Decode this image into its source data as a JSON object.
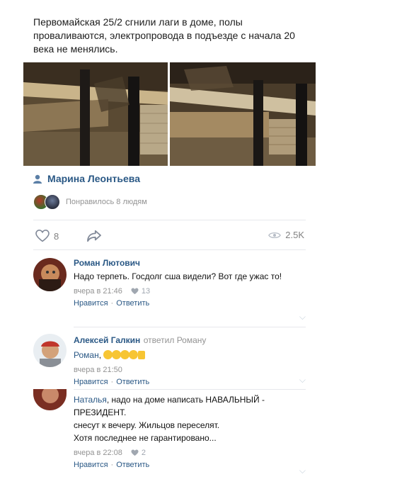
{
  "post": {
    "text": "Первомайская 25/2 сгнили лаги в доме, полы проваливаются, электропровода в подъезде с начала 20 века не менялись.",
    "author": "Марина Леонтьева",
    "likes_text": "Понравилось 8 людям",
    "like_count": "8",
    "views": "2.5K"
  },
  "comments": [
    {
      "name": "Роман Лютович",
      "text": "Надо терпеть. Госдолг сша видели? Вот где ужас то!",
      "time": "вчера в 21:46",
      "likes": "13",
      "like_label": "Нравится",
      "reply_label": "Ответить"
    },
    {
      "name": "Алексей Галкин",
      "reply_to": "ответил Роману",
      "mention": "Роман",
      "text_suffix": ",",
      "time": "вчера в 21:50",
      "like_label": "Нравится",
      "reply_label": "Ответить"
    },
    {
      "mention": "Наталья",
      "text": ", надо на доме написать НАВАЛЬНЫЙ - ПРЕЗИДЕНТ.",
      "line2": "снесут к вечеру. Жильцов переселят.",
      "line3": "Хотя последнее не гарантировано...",
      "time": "вчера в 22:08",
      "likes": "2",
      "like_label": "Нравится",
      "reply_label": "Ответить"
    }
  ],
  "separator": "·",
  "icons": {
    "author": "user-icon",
    "like": "heart-icon",
    "share": "share-icon",
    "views": "eye-icon",
    "expand": "chevron-down-icon"
  },
  "colors": {
    "link": "#2a5885",
    "muted": "#939393"
  }
}
